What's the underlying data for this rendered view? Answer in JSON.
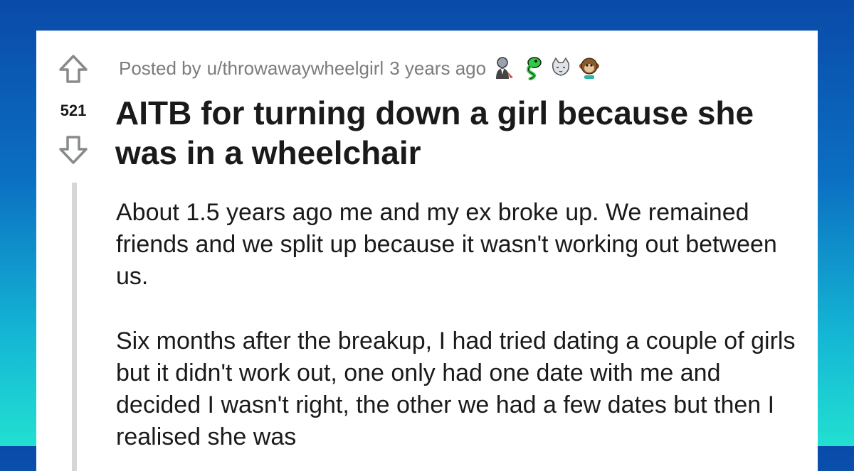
{
  "post": {
    "posted_by_prefix": "Posted by",
    "username": "u/throwawaywheelgirl",
    "time_ago": "3 years ago",
    "awards": [
      "butler-award-icon",
      "snake-award-icon",
      "cat-award-icon",
      "monkey-award-icon"
    ],
    "score": "521",
    "title": "AITB for turning down a girl because she was in a wheelchair",
    "paragraphs": [
      "About 1.5 years ago me and my ex broke up. We remained friends and we split up because it wasn't working out between us.",
      "Six months after the breakup, I had tried dating a couple of girls but it didn't work out, one only had one date with me and decided I wasn't right, the other we had a few dates but then I realised she was"
    ]
  },
  "colors": {
    "background_top": "#0a4aa8",
    "background_bottom": "#22e0d2",
    "card": "#ffffff",
    "text_primary": "#1a1a1b",
    "text_meta": "#7c7c7c",
    "thread_line": "#d6d6d6"
  }
}
